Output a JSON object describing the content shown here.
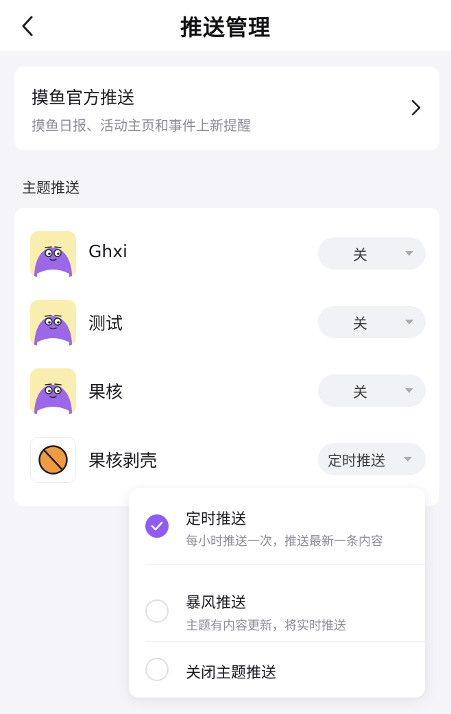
{
  "header": {
    "title": "推送管理",
    "back_icon": "chevron-left-icon"
  },
  "official": {
    "title": "摸鱼官方推送",
    "subtitle": "摸鱼日报、活动主页和事件上新提醒",
    "chevron_icon": "chevron-right-icon"
  },
  "topics_section": {
    "label": "主题推送",
    "items": [
      {
        "name": "Ghxi",
        "push_mode": "关",
        "avatar": "purple-creature-avatar"
      },
      {
        "name": "测试",
        "push_mode": "关",
        "avatar": "purple-creature-avatar"
      },
      {
        "name": "果核",
        "push_mode": "关",
        "avatar": "purple-creature-avatar"
      },
      {
        "name": "果核剥壳",
        "push_mode": "定时推送",
        "avatar": "orange-ball-avatar"
      }
    ]
  },
  "push_options": {
    "selected_index": 0,
    "items": [
      {
        "title": "定时推送",
        "description": "每小时推送一次，推送最新一条内容"
      },
      {
        "title": "暴风推送",
        "description": "主题有内容更新，将实时推送"
      },
      {
        "title": "关闭主题推送",
        "description": ""
      }
    ]
  },
  "colors": {
    "accent": "#8e5cf2",
    "background": "#f5f5f9",
    "card": "#ffffff",
    "muted_text": "#8d8d96",
    "select_bg": "#f1f2f6",
    "avatar_yellow": "#f9eeae",
    "avatar_purple": "#9a68e8",
    "avatar_orange": "#f09a42"
  }
}
